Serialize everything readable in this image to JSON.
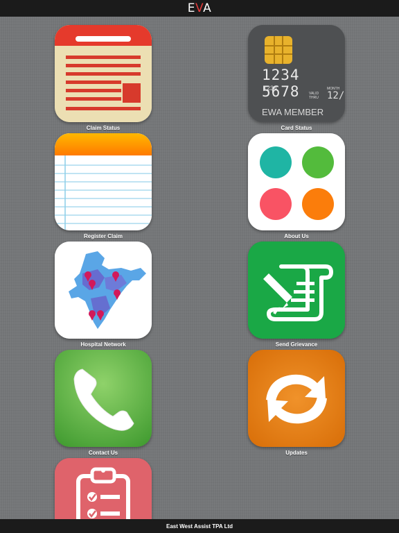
{
  "header": {
    "logo_prefix": "E",
    "logo_accent": "V",
    "logo_suffix": "A"
  },
  "tiles": [
    {
      "label": "Claim Status",
      "icon": "document-icon"
    },
    {
      "label": "Card Status",
      "icon": "credit-card-icon"
    },
    {
      "label": "Register Claim",
      "icon": "notepad-icon"
    },
    {
      "label": "About Us",
      "icon": "four-dots-icon"
    },
    {
      "label": "Hospital Network",
      "icon": "india-map-icon"
    },
    {
      "label": "Send Grievance",
      "icon": "scroll-pen-icon"
    },
    {
      "label": "Contact Us",
      "icon": "phone-icon"
    },
    {
      "label": "Updates",
      "icon": "refresh-arrows-icon"
    },
    {
      "label": "",
      "icon": "clipboard-checklist-icon"
    }
  ],
  "card": {
    "number": "1234 5678",
    "sub_number": "1234",
    "valid_label_1": "VALID",
    "valid_label_2": "THRU",
    "month_label": "MONTH",
    "expiry_partial": "12/",
    "member_text": "EWA MEMBER"
  },
  "footer": {
    "text": "East West Assist TPA Ltd"
  },
  "colors": {
    "bar": "#1b1b1b",
    "background": "#747678",
    "logo_accent": "#e23b3b"
  }
}
